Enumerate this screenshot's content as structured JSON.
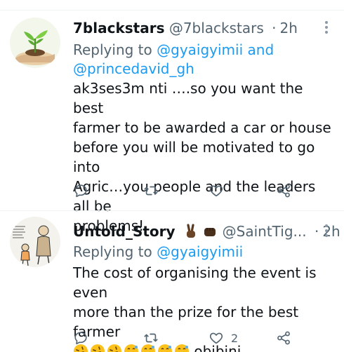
{
  "tweets": [
    {
      "display_name": "7blackstars",
      "handle": "@7blackstars",
      "separator": "·",
      "time": "2h",
      "replying_prefix": "Replying to",
      "mentions": [
        "@gyaigyimii",
        "@princedavid_gh"
      ],
      "mention_joiner": "and",
      "text_lines": [
        "ak3ses3m nti ….so you want the best",
        "farmer to be awarded a car or house",
        "before you will be motivated to go into",
        "Agric…you people and the leaders all be",
        "problems!"
      ],
      "actions": {
        "reply": "",
        "retweet": "",
        "like": "",
        "share": ""
      },
      "avatar_icon": "plant-in-hand-icon"
    },
    {
      "display_name": "Untold_Story",
      "name_emojis": [
        "victory-hand-icon",
        "fist-icon"
      ],
      "handle": "@SaintTig...",
      "separator": "·",
      "time": "2h",
      "replying_prefix": "Replying to",
      "mentions": [
        "@gyaigyimii"
      ],
      "text_lines": [
        "The cost of organising the event is even",
        "more than the prize for the best farmer"
      ],
      "text_suffix": "obibini",
      "emojis": [
        "rofl-icon",
        "rofl-icon",
        "rofl-icon",
        "grinning-sweat-icon",
        "grinning-sweat-icon",
        "grinning-sweat-icon",
        "grinning-sweat-icon"
      ],
      "actions": {
        "reply": "",
        "retweet": "",
        "like": "2",
        "share": ""
      },
      "avatar_icon": "cartoon-sketch-icon"
    }
  ],
  "colors": {
    "text": "#0f1419",
    "secondary": "#536471",
    "link": "#1d9bf0",
    "divider": "#eff3f4"
  }
}
